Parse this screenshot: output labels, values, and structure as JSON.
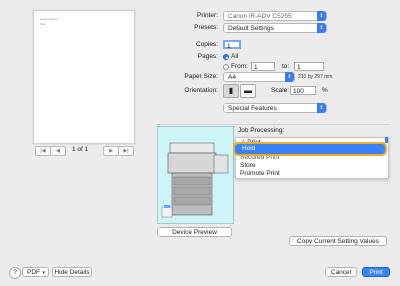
{
  "preview": {
    "page_text_1": "Lorem ipsum",
    "page_text_2": "Text",
    "pager_first": "|◀",
    "pager_prev": "◀",
    "pager_next": "▶",
    "pager_last": "▶|",
    "page_indicator": "1 of 1"
  },
  "form": {
    "printer_label": "Printer:",
    "printer_value": "Canon iR-ADV C5255",
    "presets_label": "Presets:",
    "presets_value": "Default Settings",
    "copies_label": "Copies:",
    "copies_value": "1",
    "pages_label": "Pages:",
    "pages_all": "All",
    "pages_from_label": "From:",
    "pages_from_value": "1",
    "pages_to_label": "to:",
    "pages_to_value": "1",
    "paper_size_label": "Paper Size:",
    "paper_size_value": "A4",
    "paper_size_dims": "210 by 297 mm",
    "orientation_label": "Orientation:",
    "scale_label": "Scale:",
    "scale_value": "100",
    "scale_unit": "%",
    "section_value": "Special Features"
  },
  "job": {
    "label": "Job Processing:",
    "options": [
      "Print",
      "Hold",
      "Secured Print",
      "Store",
      "Promote Print"
    ],
    "checked": "Print",
    "highlighted": "Hold"
  },
  "buttons": {
    "device_preview": "Device Preview",
    "copy_settings": "Copy Current Setting Values",
    "pdf": "PDF",
    "hide_details": "Hide Details",
    "cancel": "Cancel",
    "print": "Print",
    "help": "?"
  },
  "colors": {
    "accent": "#3b82f6",
    "highlight_ring": "#f3ac28",
    "device_bg": "#cdf4f6"
  }
}
